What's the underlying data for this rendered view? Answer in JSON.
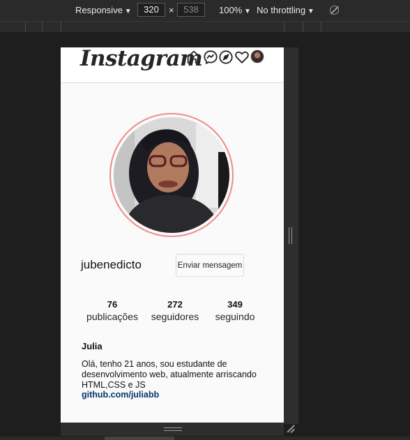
{
  "devtools": {
    "device_mode": "Responsive",
    "width": "320",
    "height": "538",
    "times": "×",
    "zoom": "100%",
    "throttling": "No throttling"
  },
  "instagram": {
    "logo": "Instagram",
    "nav_icons": [
      "home-icon",
      "messenger-icon",
      "explore-icon",
      "heart-icon"
    ],
    "username": "jubenedicto",
    "message_button": "Enviar mensagem",
    "stats": [
      {
        "value": "76",
        "label": "publicações"
      },
      {
        "value": "272",
        "label": "seguidores"
      },
      {
        "value": "349",
        "label": "seguindo"
      }
    ],
    "full_name": "Julia",
    "bio": "Olá, tenho 21 anos, sou estudante de desenvolvimento web, atualmente arriscando HTML,CSS e JS",
    "link": "github.com/juliabb",
    "ring_color": "#ee8a8a",
    "link_color": "#00376b"
  }
}
